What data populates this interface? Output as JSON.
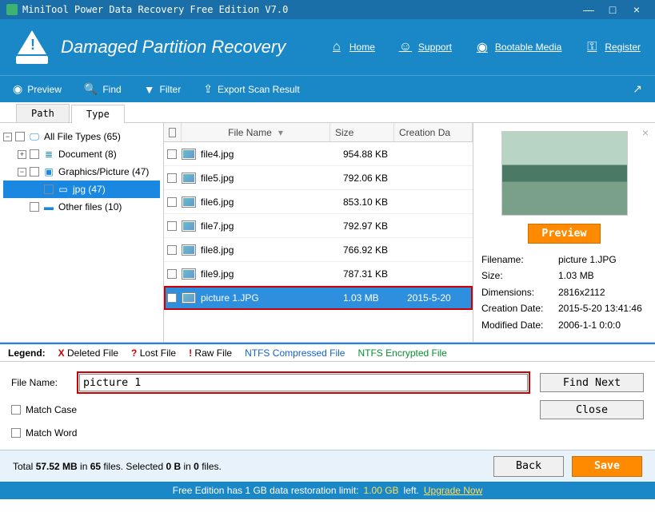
{
  "window": {
    "title": "MiniTool Power Data Recovery Free Edition V7.0",
    "minimize": "—",
    "maximize": "□",
    "close": "×"
  },
  "header": {
    "brand": "Damaged Partition Recovery",
    "links": {
      "home": "Home",
      "support": "Support",
      "bootable": "Bootable Media",
      "register": "Register"
    }
  },
  "toolbar": {
    "preview": "Preview",
    "find": "Find",
    "filter": "Filter",
    "export": "Export Scan Result"
  },
  "tabs": {
    "path": "Path",
    "type": "Type"
  },
  "tree": {
    "root": "All File Types (65)",
    "doc": "Document (8)",
    "gfx": "Graphics/Picture (47)",
    "jpg": "jpg (47)",
    "other": "Other files (10)"
  },
  "columns": {
    "name": "File Name",
    "size": "Size",
    "date": "Creation Da"
  },
  "files": [
    {
      "name": "file4.jpg",
      "size": "954.88 KB",
      "date": ""
    },
    {
      "name": "file5.jpg",
      "size": "792.06 KB",
      "date": ""
    },
    {
      "name": "file6.jpg",
      "size": "853.10 KB",
      "date": ""
    },
    {
      "name": "file7.jpg",
      "size": "792.97 KB",
      "date": ""
    },
    {
      "name": "file8.jpg",
      "size": "766.92 KB",
      "date": ""
    },
    {
      "name": "file9.jpg",
      "size": "787.31 KB",
      "date": ""
    },
    {
      "name": "picture 1.JPG",
      "size": "1.03 MB",
      "date": "2015-5-20",
      "selected": true
    }
  ],
  "preview": {
    "button": "Preview",
    "meta": {
      "filename_k": "Filename:",
      "filename_v": "picture 1.JPG",
      "size_k": "Size:",
      "size_v": "1.03 MB",
      "dim_k": "Dimensions:",
      "dim_v": "2816x2112",
      "cdate_k": "Creation Date:",
      "cdate_v": "2015-5-20 13:41:46",
      "mdate_k": "Modified Date:",
      "mdate_v": "2006-1-1 0:0:0"
    }
  },
  "legend": {
    "label": "Legend:",
    "deleted": "Deleted File",
    "lost": "Lost File",
    "raw": "Raw File",
    "ntfs_c": "NTFS Compressed File",
    "ntfs_e": "NTFS Encrypted File"
  },
  "search": {
    "label": "File Name:",
    "value": "picture 1",
    "find_next": "Find Next",
    "match_case": "Match Case",
    "match_word": "Match Word",
    "close": "Close"
  },
  "footer": {
    "total_pre": "Total ",
    "total_mb": "57.52 MB",
    "total_mid": " in ",
    "total_files": "65",
    "total_mid2": " files. Selected ",
    "sel_b": "0 B",
    "sel_mid": " in ",
    "sel_files": "0",
    "sel_end": " files.",
    "back": "Back",
    "save": "Save"
  },
  "limit": {
    "pre": "Free Edition has 1 GB data restoration limit: ",
    "left": "1.00 GB",
    "post": " left. ",
    "upgrade": "Upgrade Now"
  }
}
